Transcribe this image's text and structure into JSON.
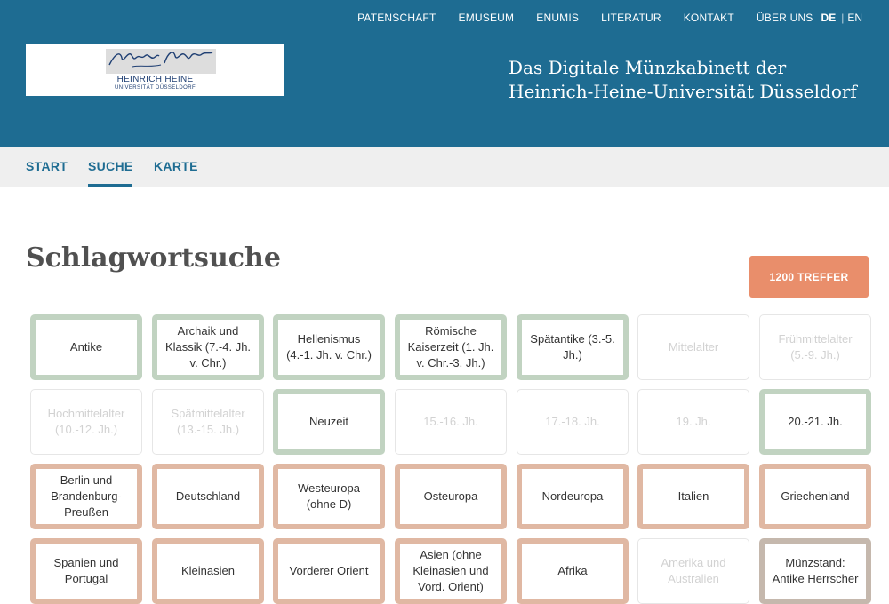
{
  "topnav": {
    "links": [
      "PATENSCHAFT",
      "EMUSEUM",
      "ENUMIS",
      "LITERATUR",
      "KONTAKT",
      "ÜBER UNS"
    ],
    "lang_de": "DE",
    "lang_sep": "|",
    "lang_en": "EN"
  },
  "logo": {
    "name": "HEINRICH HEINE",
    "sub": "UNIVERSITÄT DÜSSELDORF"
  },
  "site_title": {
    "line1": "Das Digitale Münzkabinett der",
    "line2": "Heinrich-Heine-Universität Düsseldorf"
  },
  "subnav": [
    "START",
    "SUCHE",
    "KARTE"
  ],
  "page_title": "Schlagwortsuche",
  "hits_button": "1200 TREFFER",
  "tiles": [
    {
      "label": "Antike",
      "style": "green"
    },
    {
      "label": "Archaik und Klassik (7.-4. Jh. v. Chr.)",
      "style": "green"
    },
    {
      "label": "Hellenismus (4.-1. Jh. v. Chr.)",
      "style": "green"
    },
    {
      "label": "Römische Kaiserzeit (1. Jh. v. Chr.-3. Jh.)",
      "style": "green"
    },
    {
      "label": "Spätantike (3.-5. Jh.)",
      "style": "green"
    },
    {
      "label": "Mittelalter",
      "style": "off"
    },
    {
      "label": "Frühmittelalter (5.-9. Jh.)",
      "style": "off"
    },
    {
      "label": "Hochmittelalter (10.-12. Jh.)",
      "style": "off"
    },
    {
      "label": "Spätmittelalter (13.-15. Jh.)",
      "style": "off"
    },
    {
      "label": "Neuzeit",
      "style": "green"
    },
    {
      "label": "15.-16. Jh.",
      "style": "off"
    },
    {
      "label": "17.-18. Jh.",
      "style": "off"
    },
    {
      "label": "19. Jh.",
      "style": "off"
    },
    {
      "label": "20.-21. Jh.",
      "style": "green"
    },
    {
      "label": "Berlin und Brandenburg-Preußen",
      "style": "salmon"
    },
    {
      "label": "Deutschland",
      "style": "salmon"
    },
    {
      "label": "Westeuropa (ohne D)",
      "style": "salmon"
    },
    {
      "label": "Osteuropa",
      "style": "salmon"
    },
    {
      "label": "Nordeuropa",
      "style": "salmon"
    },
    {
      "label": "Italien",
      "style": "salmon"
    },
    {
      "label": "Griechenland",
      "style": "salmon"
    },
    {
      "label": "Spanien und Portugal",
      "style": "salmon"
    },
    {
      "label": "Kleinasien",
      "style": "salmon"
    },
    {
      "label": "Vorderer Orient",
      "style": "salmon"
    },
    {
      "label": "Asien (ohne Kleinasien und Vord. Orient)",
      "style": "salmon"
    },
    {
      "label": "Afrika",
      "style": "salmon"
    },
    {
      "label": "Amerika und Australien",
      "style": "off"
    },
    {
      "label": "Münzstand: Antike Herrscher",
      "style": "taupe"
    }
  ],
  "colors": {
    "header_blue": "#1e6c92",
    "hits_orange": "#e98e6b",
    "tile_green": "#c1d3c1",
    "tile_salmon": "#e0b8a3",
    "tile_taupe": "#c5b8ad"
  }
}
